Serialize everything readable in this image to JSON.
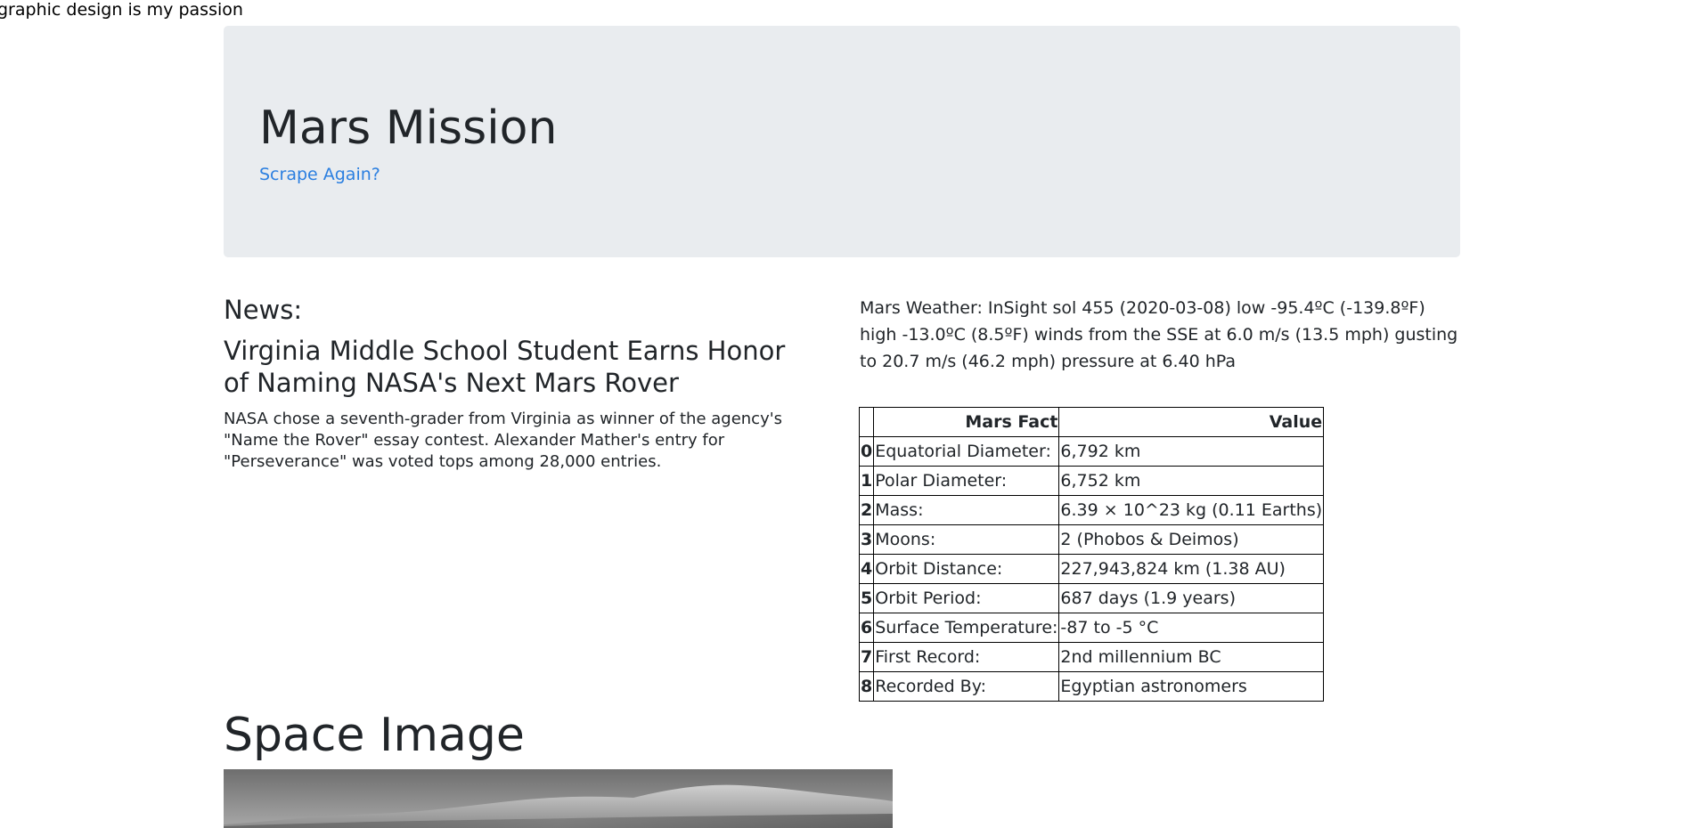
{
  "tagline": "graphic design is my passion",
  "jumbotron": {
    "title": "Mars Mission",
    "scrape_link": "Scrape Again?"
  },
  "news": {
    "heading": "News:",
    "title": "Virginia Middle School Student Earns Honor of Naming NASA's Next Mars Rover",
    "paragraph": "NASA chose a seventh-grader from Virginia as winner of the agency's \"Name the Rover\" essay contest. Alexander Mather's entry for \"Perseverance\" was voted tops among 28,000 entries."
  },
  "weather": {
    "text": "Mars Weather: InSight sol 455 (2020-03-08) low -95.4ºC (-139.8ºF) high -13.0ºC (8.5ºF) winds from the SSE at 6.0 m/s (13.5 mph) gusting to 20.7 m/s (46.2 mph) pressure at 6.40 hPa"
  },
  "facts_table": {
    "headers": [
      "",
      "Mars Fact",
      "Value"
    ],
    "rows": [
      {
        "index": "0",
        "fact": "Equatorial Diameter:",
        "value": "6,792 km"
      },
      {
        "index": "1",
        "fact": "Polar Diameter:",
        "value": "6,752 km"
      },
      {
        "index": "2",
        "fact": "Mass:",
        "value": "6.39 × 10^23 kg (0.11 Earths)"
      },
      {
        "index": "3",
        "fact": "Moons:",
        "value": "2 (Phobos & Deimos)"
      },
      {
        "index": "4",
        "fact": "Orbit Distance:",
        "value": "227,943,824 km (1.38 AU)"
      },
      {
        "index": "5",
        "fact": "Orbit Period:",
        "value": "687 days (1.9 years)"
      },
      {
        "index": "6",
        "fact": "Surface Temperature:",
        "value": "-87 to -5 °C"
      },
      {
        "index": "7",
        "fact": "First Record:",
        "value": "2nd millennium BC"
      },
      {
        "index": "8",
        "fact": "Recorded By:",
        "value": "Egyptian astronomers"
      }
    ]
  },
  "space_image": {
    "heading": "Space Image"
  },
  "colors": {
    "jumbotron_bg": "#e9ecef",
    "link": "#2b7fe0",
    "text": "#212529"
  }
}
